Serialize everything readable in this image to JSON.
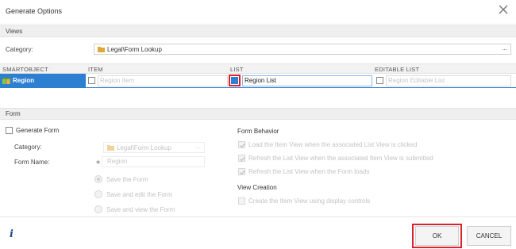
{
  "dialog": {
    "title": "Generate Options"
  },
  "views": {
    "section_label": "Views",
    "category_label": "Category:",
    "category_value": "Legal\\Form Lookup",
    "ellipsis": "..."
  },
  "table": {
    "headers": [
      "SMARTOBJECT",
      "ITEM",
      "LIST",
      "EDITABLE LIST"
    ],
    "row": {
      "smartobject": "Region",
      "item_placeholder": "Region Item",
      "list_value": "Region List",
      "editable_list_placeholder": "Region Editable List"
    }
  },
  "form": {
    "section_label": "Form",
    "generate_label": "Generate Form",
    "category_label": "Category:",
    "category_value": "Legal\\Form Lookup",
    "ellipsis": "...",
    "name_label": "Form Name:",
    "name_placeholder": "Region",
    "save_options": [
      "Save the Form",
      "Save and edit the Form",
      "Save and view the Form"
    ],
    "behavior_heading": "Form Behavior",
    "behavior_options": [
      "Load the Item View when the associated List View is clicked",
      "Refresh the List View when the associated Item View is submitted",
      "Refresh the List View when the Form loads"
    ],
    "creation_heading": "View Creation",
    "creation_option": "Create the Item View using display controls"
  },
  "footer": {
    "info": "i",
    "ok_label": "OK",
    "cancel_label": "CANCEL"
  },
  "colors": {
    "accent": "#2d7fd2",
    "highlight": "#d9232e"
  }
}
